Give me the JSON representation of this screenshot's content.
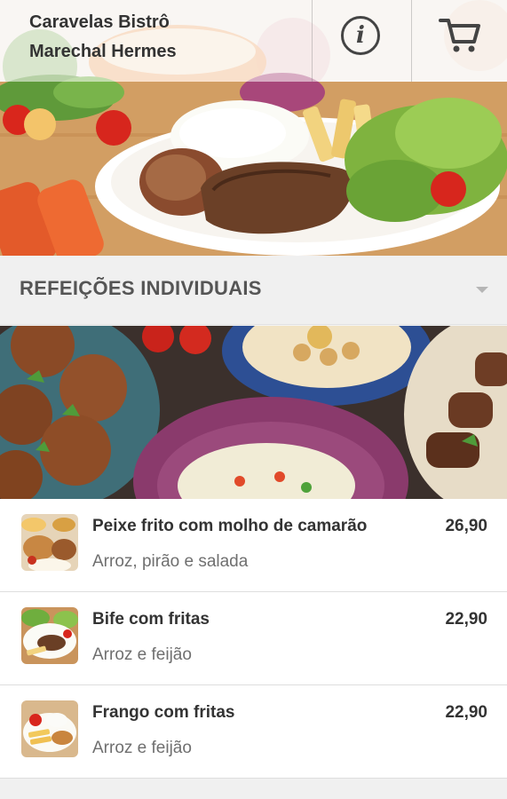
{
  "header": {
    "restaurant_name": "Caravelas Bistrô",
    "branch": "Marechal Hermes",
    "info_icon": "info-icon",
    "cart_icon": "cart-icon"
  },
  "category": {
    "title": "REFEIÇÕES INDIVIDUAIS",
    "expand_icon": "caret-down-icon"
  },
  "menu": {
    "items": [
      {
        "name": "Peixe frito com molho de camarão",
        "description": "Arroz, pirão e salada",
        "price": "26,90"
      },
      {
        "name": "Bife com fritas",
        "description": "Arroz e feijão",
        "price": "22,90"
      },
      {
        "name": "Frango com fritas",
        "description": "Arroz e feijão",
        "price": "22,90"
      }
    ]
  },
  "colors": {
    "text_dark": "#333333",
    "text_muted": "#6f6f6f",
    "category_bar": "#f0f0f0",
    "card": "#ffffff"
  }
}
